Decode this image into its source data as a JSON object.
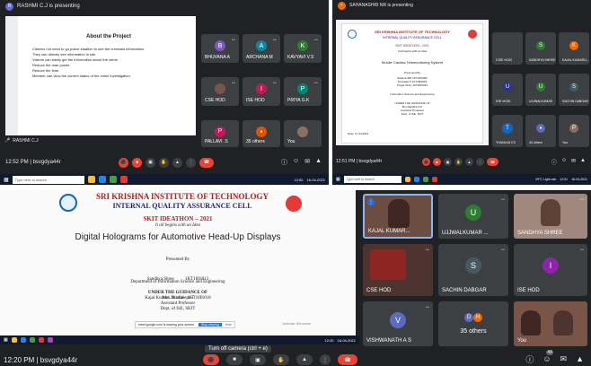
{
  "q1": {
    "presenting": "RASHMI C.J is presenting",
    "presenter_initial": "R",
    "slide_title": "About the Project",
    "bullets": [
      "Citizens not need to go police staation to see the criminals information.",
      "They can directly see information in site.",
      "Visitors can easily get the information about the crime.",
      "Reduce the man power.",
      "Reduce the time.",
      "Member can view the current status of the crime investigation."
    ],
    "tiles": [
      {
        "initial": "B",
        "name": "BHUVANA A",
        "color": "#7e57c2"
      },
      {
        "initial": "A",
        "name": "ARCHANA M",
        "color": "#0b8a9e"
      },
      {
        "initial": "K",
        "name": "KAVYAVI V.S",
        "color": "#2e7d32"
      },
      {
        "initial": "",
        "name": "CSE HOD",
        "color": "#795548"
      },
      {
        "initial": "I",
        "name": "ISE HOD",
        "color": "#c2185b"
      },
      {
        "initial": "P",
        "name": "PRIYA G.K",
        "color": "#00897b"
      },
      {
        "initial": "P",
        "name": "PALLAVI .S",
        "color": "#c2185b"
      },
      {
        "initial": "",
        "name": "35 others",
        "color": "#e65100"
      },
      {
        "initial": "",
        "name": "You",
        "color": "#8d6e63"
      }
    ],
    "presenter_name": "RASHMI C.J",
    "time_code": "12:52 PM  |  bsvgdya44r",
    "search_placeholder": "Type here to search",
    "clock": "12:52",
    "date": "16-04-2021"
  },
  "q2": {
    "presenting": "SAHANASHRI NR is presenting",
    "inst": "SRI KRISHNA INSTITUTE OF TECHNOLOGY",
    "cell": "INTERNAL QUALITY ASSURANCE CELL",
    "event": "SKIT IDEATHON - 2021",
    "tagline": "It all begins with an Idea",
    "project": "Mobile Cardiac Telemonitoring System",
    "presented_by": "Presented By",
    "students": [
      "Sahana SRI   1KT18IS052",
      "Thrisaala S   1KT18IS063",
      "Poojar Ruby   1KT18IS043"
    ],
    "dept": "Information Science and Engineering",
    "guidance": "UNDER THE GUIDANCE OF",
    "guide": "Mrs.Ranjitha S.P",
    "guide_role": "Assistant Professor",
    "guide_dept": "Dept. of ISE, SKIT",
    "date_label": "Date: 17-04-2021",
    "tiles": [
      {
        "initial": "",
        "name": "CSE HOD",
        "color": "#3c4043"
      },
      {
        "initial": "S",
        "name": "SANDHYA SHREE",
        "color": "#2e7d32"
      },
      {
        "initial": "K",
        "name": "KAJAL KUMARIJ...",
        "color": "#ef6c00"
      },
      {
        "initial": "U",
        "name": "ISE HOD",
        "color": "#283593"
      },
      {
        "initial": "U",
        "name": "UJJWALKUMAR",
        "color": "#2e7d32"
      },
      {
        "initial": "S",
        "name": "SACHIN DABGAR",
        "color": "#455a64"
      },
      {
        "initial": "T",
        "name": "THANUJA CS",
        "color": "#1565c0"
      },
      {
        "initial": "",
        "name": "34 others",
        "color": "#5c6bc0"
      },
      {
        "initial": "P",
        "name": "You",
        "color": "#8d6e63"
      }
    ],
    "time_code": "12:51 PM  |  bsvgdya44r",
    "search_placeholder": "Type here to search",
    "weather": "29°C  Light rain",
    "clock": "12:51",
    "date": "16-04-2021"
  },
  "q3": {
    "inst": "SRI KRISHNA INSTITUTE OF TECHNOLOGY",
    "cell": "INTERNAL QUALITY ASSURANCE CELL",
    "event": "SKIT IDEATHON – 2021",
    "tagline": "It all begins with an Idea",
    "title": "Digital Holograms for Automotive Head-Up Displays",
    "presented_by": "Presented By",
    "students": [
      "Sandhya Shree          1KT18IS013",
      "Kajal Kumari Jaiswal   1KT18IS018"
    ],
    "dept": "Department of Information Science and Engineering",
    "guidance": "UNDER THE GUIDANCE OF",
    "guide": "Mrs. Pradheepa J",
    "guide_role": "Assistant Professor",
    "guide_dept": "Dept. of ISE, SKIT",
    "share_note": "meet.google.com is sharing your screen.",
    "stop_sharing": "Stop sharing",
    "hide": "Hide",
    "activate": "Activate Windows",
    "tooltip": "Turn off camera (ctrl + e)",
    "time_code": "12:20 PM  |  bsvgdya44r",
    "search_placeholder": "Type here to search",
    "clock": "12:20",
    "date": "16-04-2021"
  },
  "q4": {
    "tiles": [
      {
        "initial": "",
        "name": "KAJAL KUMAR...",
        "color": "#6d4c41"
      },
      {
        "initial": "U",
        "name": "UJJWALKUMAR ...",
        "color": "#2e7d32"
      },
      {
        "initial": "",
        "name": "SANDHYA SHREE",
        "color": "#a1887f"
      },
      {
        "initial": "",
        "name": "CSE HOD",
        "color": "#4e342e"
      },
      {
        "initial": "S",
        "name": "SACHIN DABGAR",
        "color": "#455a64"
      },
      {
        "initial": "I",
        "name": "ISE HOD",
        "color": "#8e24aa"
      },
      {
        "initial": "V",
        "name": "VISHWANATH A S",
        "color": "#5c6bc0"
      },
      {
        "initial": "",
        "name": "35 others",
        "color": "#3c4043"
      },
      {
        "initial": "",
        "name": "You",
        "color": "#795548"
      }
    ],
    "others_d": "D",
    "others_h": "H",
    "people_count": "44"
  }
}
